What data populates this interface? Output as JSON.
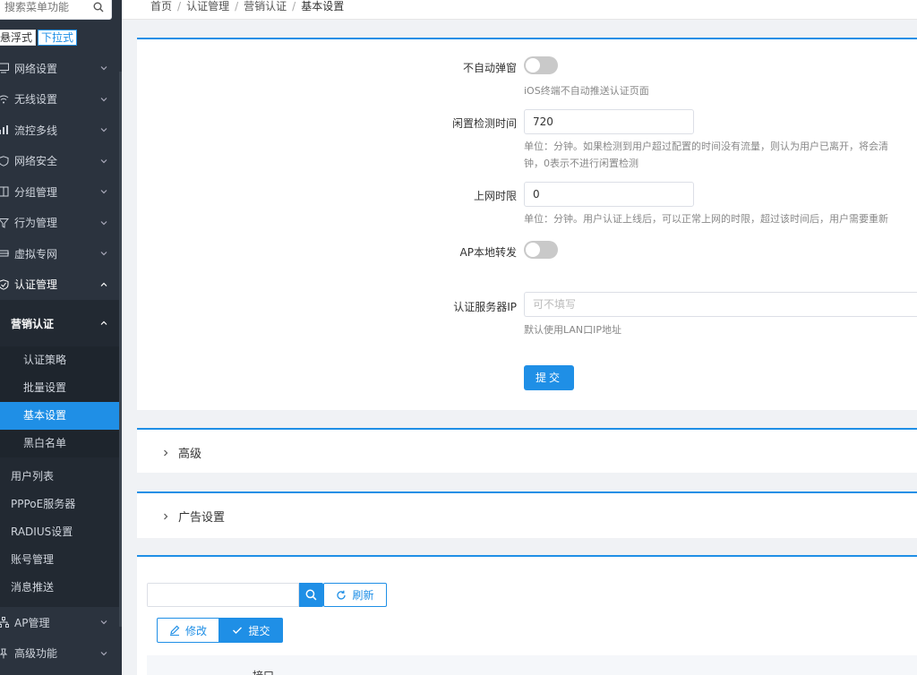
{
  "sidebar": {
    "search_placeholder": "搜索菜单功能",
    "mode_float": "悬浮式",
    "mode_dropdown": "下拉式",
    "items": [
      {
        "label": "网络设置",
        "icon": "monitor-icon"
      },
      {
        "label": "无线设置",
        "icon": "wifi-icon"
      },
      {
        "label": "流控多线",
        "icon": "chart-icon"
      },
      {
        "label": "网络安全",
        "icon": "shield-icon"
      },
      {
        "label": "分组管理",
        "icon": "group-icon"
      },
      {
        "label": "行为管理",
        "icon": "filter-icon"
      },
      {
        "label": "虚拟专网",
        "icon": "vpn-icon"
      },
      {
        "label": "认证管理",
        "icon": "shield-check-icon"
      }
    ],
    "auth_sub": {
      "head": "营销认证",
      "items": [
        "认证策略",
        "批量设置",
        "基本设置",
        "黑白名单"
      ],
      "active": "基本设置"
    },
    "auth_more": [
      "用户列表",
      "PPPoE服务器",
      "RADIUS设置",
      "账号管理",
      "消息推送"
    ],
    "bottom_items": [
      {
        "label": "AP管理",
        "icon": "network-icon"
      },
      {
        "label": "高级功能",
        "icon": "pin-icon"
      }
    ]
  },
  "breadcrumb": [
    "首页",
    "认证管理",
    "营销认证",
    "基本设置"
  ],
  "form": {
    "no_popup_label": "不自动弹窗",
    "no_popup_hint": "iOS终端不自动推送认证页面",
    "no_popup_on": false,
    "idle_label": "闲置检测时间",
    "idle_value": "720",
    "idle_hint_1": "单位：分钟。如果检测到用户超过配置的时间没有流量，则认为用户已离开，将会清",
    "idle_hint_2": "钟，0表示不进行闲置检测",
    "limit_label": "上网时限",
    "limit_value": "0",
    "limit_hint": "单位：分钟。用户认证上线后，可以正常上网的时限，超过该时间后，用户需要重新",
    "ap_label": "AP本地转发",
    "ap_on": false,
    "server_label": "认证服务器IP",
    "server_placeholder": "可不填写",
    "server_hint": "默认使用LAN口IP地址",
    "submit": "提交"
  },
  "advanced": {
    "title": "高级"
  },
  "ad": {
    "title": "广告设置"
  },
  "list": {
    "refresh": "刷新",
    "edit": "修改",
    "submit": "提交",
    "col_interface": "接口"
  },
  "colors": {
    "accent": "#1f8fe6",
    "sidebar_bg": "#2b333e"
  }
}
